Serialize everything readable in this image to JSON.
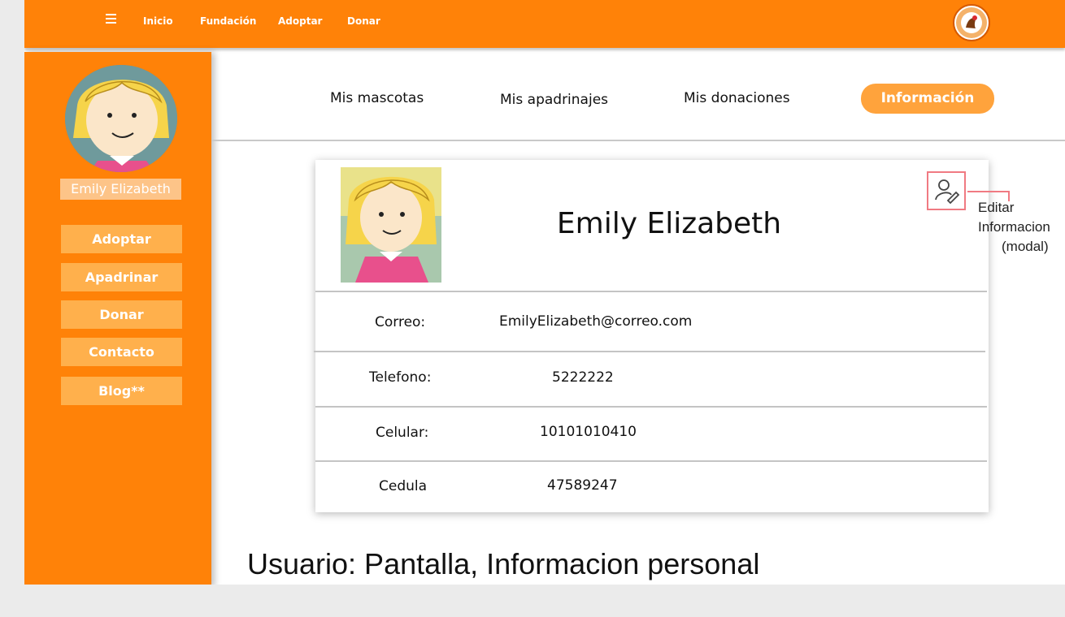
{
  "nav": {
    "links": [
      "Inicio",
      "Fundación",
      "Adoptar",
      "Donar"
    ],
    "menu_icon": "hamburger-icon",
    "logo_icon": "foundation-logo"
  },
  "sidebar": {
    "user_name": "Emily Elizabeth",
    "buttons": [
      "Adoptar",
      "Apadrinar",
      "Donar",
      "Contacto",
      "Blog**"
    ]
  },
  "tabs": {
    "items": [
      "Mis mascotas",
      "Mis apadrinajes",
      "Mis donaciones"
    ],
    "active": "Información"
  },
  "profile": {
    "name": "Emily Elizabeth",
    "edit_icon": "user-edit-icon",
    "fields": [
      {
        "label": "Correo:",
        "value": "EmilyElizabeth@correo.com"
      },
      {
        "label": "Telefono:",
        "value": "5222222"
      },
      {
        "label": "Celular:",
        "value": "10101010410"
      },
      {
        "label": "Cedula",
        "value": "47589247"
      }
    ]
  },
  "annotation": {
    "line1": "Editar",
    "line2": "Informacion",
    "line3": "(modal)"
  },
  "caption": "Usuario: Pantalla, Informacion personal",
  "colors": {
    "brand_orange": "#ff8208",
    "button_orange": "#ffb04c",
    "active_tab": "#ffa33c",
    "annotation_red": "#f07a82"
  }
}
